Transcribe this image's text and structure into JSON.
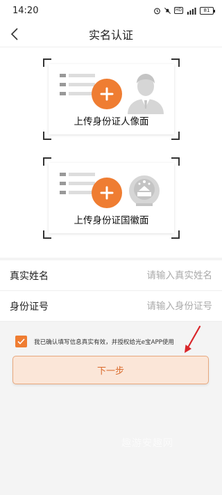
{
  "status_bar": {
    "time": "14:20",
    "battery": "81"
  },
  "nav": {
    "title": "实名认证"
  },
  "upload": {
    "front_label": "上传身份证人像面",
    "back_label": "上传身份证国徽面"
  },
  "form": {
    "name_label": "真实姓名",
    "name_placeholder": "请输入真实姓名",
    "name_value": "",
    "id_label": "身份证号",
    "id_placeholder": "请输入身份证号",
    "id_value": ""
  },
  "agreement": {
    "checked": true,
    "text": "我已确认填写信息真实有效，并授权给光e宝APP使用"
  },
  "next_button": {
    "label": "下一步"
  },
  "watermark": "趣游安趣网",
  "colors": {
    "accent": "#ef7d32",
    "annotation_arrow": "#d9262a"
  }
}
